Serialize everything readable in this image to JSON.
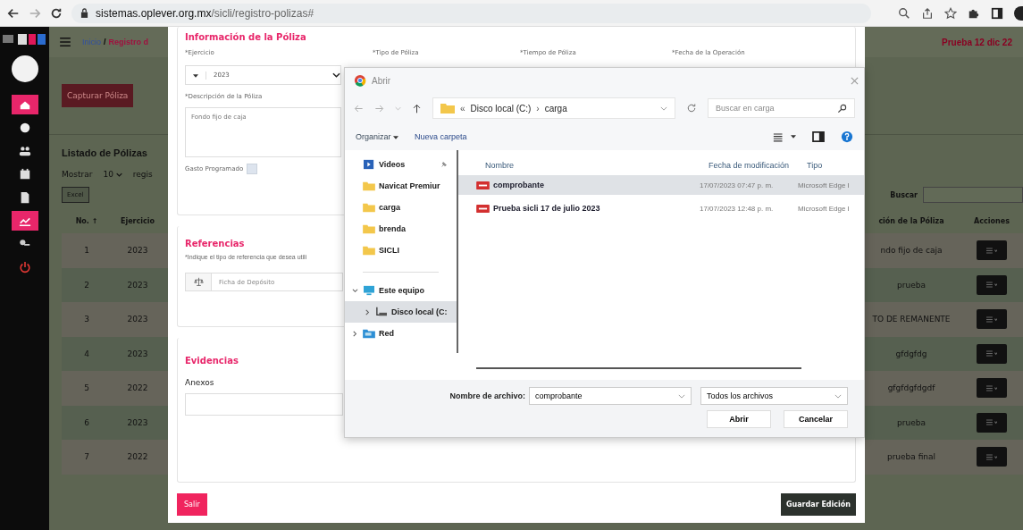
{
  "browser": {
    "url_host": "sistemas.oplever.org.mx",
    "url_path": "/sicli/registro-polizas#"
  },
  "sidebar": {
    "items": [
      {
        "kind": "home",
        "selected": true
      },
      {
        "kind": "circle",
        "selected": false
      },
      {
        "kind": "users",
        "selected": false
      },
      {
        "kind": "calendar",
        "selected": false
      },
      {
        "kind": "document",
        "selected": false
      },
      {
        "kind": "chart",
        "selected": true
      },
      {
        "kind": "key",
        "selected": false
      },
      {
        "kind": "power",
        "selected": false
      }
    ]
  },
  "page": {
    "breadcrumb": {
      "home": "Inicio",
      "separator": "/",
      "current": "Registro d"
    },
    "user": "Prueba 12 dic 22",
    "capture_button": "Capturar Póliza",
    "list_title": "Listado de Pólizas",
    "show_label": "Mostrar",
    "page_size": "10",
    "show_suffix": "regis",
    "excel_button": "Excel",
    "search_label": "Buscar",
    "table": {
      "columns": [
        "No. ↑",
        "Ejercicio",
        "ción de la Póliza",
        "Acciones"
      ],
      "rows": [
        {
          "no": "1",
          "year": "2023",
          "description": "ndo fijo de caja"
        },
        {
          "no": "2",
          "year": "2023",
          "description": "prueba"
        },
        {
          "no": "3",
          "year": "2023",
          "description": "TO DE REMANENTE"
        },
        {
          "no": "4",
          "year": "2023",
          "description": "gfdgfdg"
        },
        {
          "no": "5",
          "year": "2022",
          "description": "gfgfdgfdgdf"
        },
        {
          "no": "6",
          "year": "2023",
          "description": "prueba"
        },
        {
          "no": "7",
          "year": "2022",
          "description": "prueba final"
        }
      ]
    }
  },
  "modal": {
    "info_title": "Información de la Póliza",
    "labels": [
      "*Ejercicio",
      "*Tipo de Póliza",
      "*Tiempo de Póliza",
      "*Fecha de la Operación"
    ],
    "year_value": "2023",
    "description_label": "*Descripción de la Póliza",
    "description_value": "Fondo fijo de caja",
    "scheduled_label": "Gasto Programado",
    "scheduled_checked": false,
    "references_title": "Referencias",
    "references_hint": "*Indique el tipo de referencia que desea utili",
    "reference_placeholder": "Ficha de Depósito",
    "evidence_title": "Evidencias",
    "attachments_label": "Anexos",
    "exit_button": "Salir",
    "save_button": "Guardar Edición"
  },
  "dialog": {
    "title": "Abrir",
    "path": {
      "prefix": "«",
      "drive": "Disco local (C:)",
      "separator": "›",
      "folder": "carga"
    },
    "search_placeholder": "Buscar en carga",
    "organize": "Organizar",
    "new_folder": "Nueva carpeta",
    "nav": [
      {
        "label": "Videos",
        "kind": "video",
        "selected": false,
        "pinned": true
      },
      {
        "label": "Navicat Premiur",
        "kind": "folder",
        "selected": false
      },
      {
        "label": "carga",
        "kind": "folder",
        "selected": false
      },
      {
        "label": "brenda",
        "kind": "folder",
        "selected": false
      },
      {
        "label": "SICLI",
        "kind": "folder",
        "selected": false
      },
      {
        "label": "Este equipo",
        "kind": "pc",
        "selected": false,
        "expanded": true,
        "children": [
          {
            "label": "Disco local (C:",
            "kind": "drive",
            "selected": true,
            "expanded": false
          }
        ]
      },
      {
        "label": "Red",
        "kind": "network",
        "selected": false,
        "expanded": false
      }
    ],
    "columns": [
      "Nombre",
      "Fecha de modificación",
      "Tipo"
    ],
    "files": [
      {
        "name": "comprobante",
        "date": "17/07/2023 07:47 p. m.",
        "type": "Microsoft Edge I",
        "selected": true
      },
      {
        "name": "Prueba sicli 17 de julio 2023",
        "date": "17/07/2023 12:48 p. m.",
        "type": "Microsoft Edge I",
        "selected": false
      }
    ],
    "filename_label": "Nombre de archivo:",
    "filename": "comprobante",
    "filter": "Todos los archivos",
    "open_button": "Abrir",
    "cancel_button": "Cancelar"
  }
}
